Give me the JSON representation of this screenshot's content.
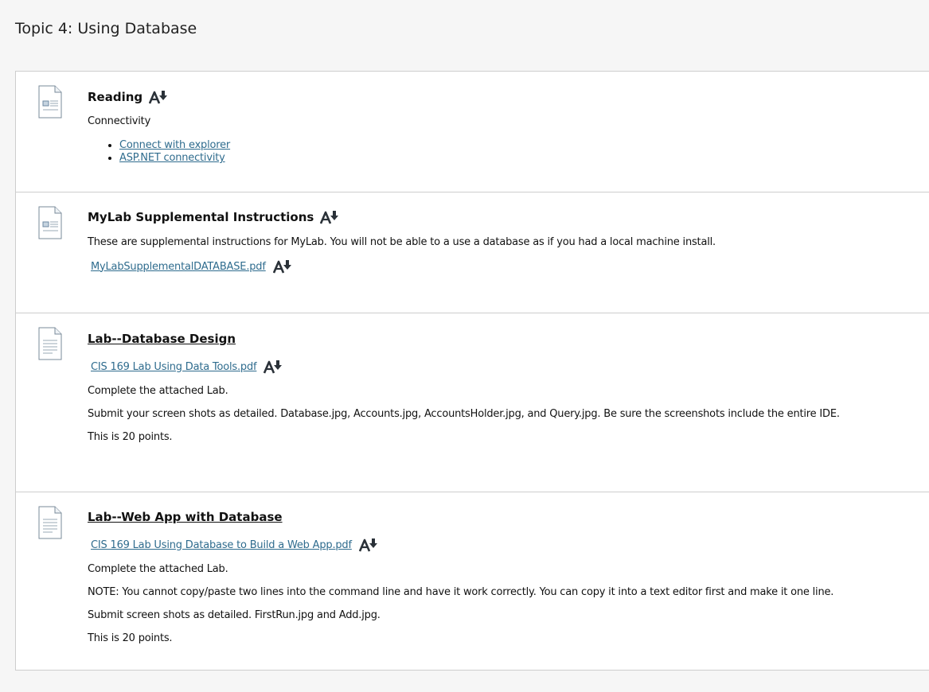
{
  "page": {
    "title": "Topic 4: Using Database"
  },
  "items": [
    {
      "title": "Reading",
      "intro": "Connectivity",
      "links": [
        "Connect with explorer",
        "ASP.NET connectivity"
      ]
    },
    {
      "title": "MyLab Supplemental Instructions",
      "description": "These are supplemental instructions for MyLab. You will not be able to a use a database as if you had a local machine install.",
      "file": "MyLabSupplementalDATABASE.pdf"
    },
    {
      "title": "Lab--Database Design",
      "file": "CIS 169 Lab Using Data Tools.pdf",
      "paragraphs": [
        "Complete the attached Lab.",
        "Submit your screen shots as detailed. Database.jpg, Accounts.jpg, AccountsHolder.jpg, and Query.jpg. Be sure the screenshots include the entire IDE.",
        "This is 20 points."
      ]
    },
    {
      "title": "Lab--Web App with Database",
      "file": "CIS 169 Lab Using Database to Build a Web App.pdf",
      "paragraphs": [
        "Complete the attached Lab.",
        "NOTE: You cannot copy/paste two lines into the command line and have it work correctly. You can copy it into a text editor first and make it one line.",
        "Submit screen shots as detailed. FirstRun.jpg and Add.jpg.",
        "This is 20 points."
      ]
    }
  ],
  "icons": {
    "item_icon": "document-icon",
    "alternative_formats": "alternative-formats-icon"
  },
  "colors": {
    "link": "#2f6c8e",
    "border": "#cdcdcd",
    "background": "#f6f6f6"
  }
}
